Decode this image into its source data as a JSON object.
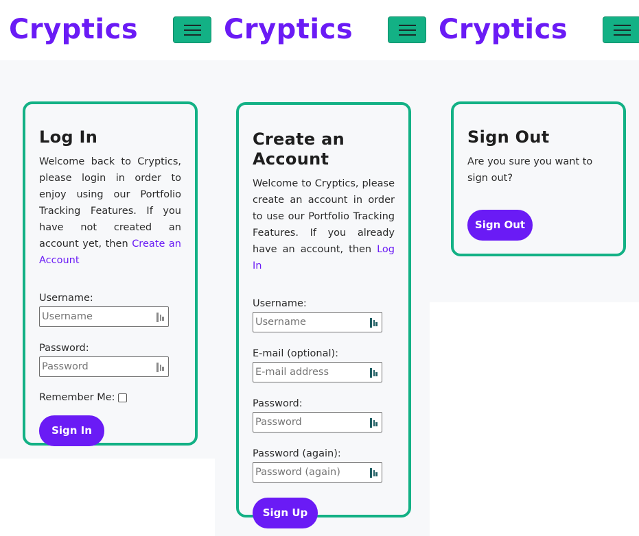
{
  "brand": "Cryptics",
  "login": {
    "title": "Log In",
    "desc": "Welcome back to Cryptics, please login in order to enjoy using our Portfolio Tracking Features. If you have not created an account yet, then",
    "link": "Create an Account",
    "username_label": "Username:",
    "username_placeholder": "Username",
    "password_label": "Password:",
    "password_placeholder": "Password",
    "remember_label": "Remember Me:",
    "button": "Sign In"
  },
  "signup": {
    "title": "Create an Account",
    "desc": "Welcome to Cryptics, please create an account in order to use our Portfolio Tracking Features. If you already have an account, then",
    "link": "Log In",
    "username_label": "Username:",
    "username_placeholder": "Username",
    "email_label": "E-mail (optional):",
    "email_placeholder": "E-mail address",
    "password_label": "Password:",
    "password_placeholder": "Password",
    "password2_label": "Password (again):",
    "password2_placeholder": "Password (again)",
    "button": "Sign Up"
  },
  "signout": {
    "title": "Sign Out",
    "desc": "Are you sure you want to sign out?",
    "button": "Sign Out"
  },
  "icons": {
    "menu": "hamburger-menu-icon",
    "password_manager": "password-manager-key-icon"
  },
  "colors": {
    "brand": "#6a1bf5",
    "accent": "#13b185"
  }
}
